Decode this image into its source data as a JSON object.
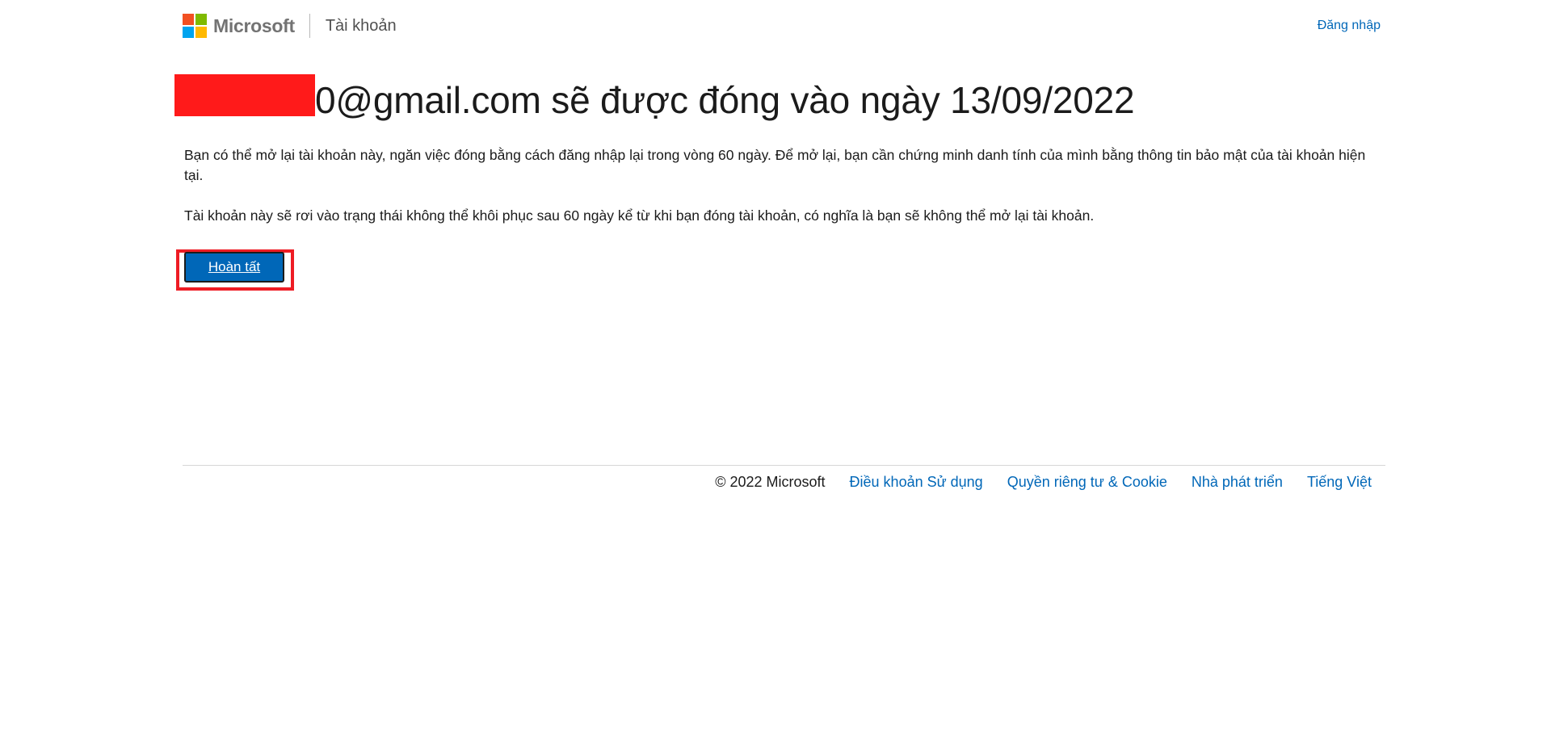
{
  "header": {
    "brand": "Microsoft",
    "section": "Tài khoản",
    "signin": "Đăng nhập",
    "logo_colors": [
      "#f25022",
      "#7fba00",
      "#00a4ef",
      "#ffb900"
    ]
  },
  "main": {
    "title": "0@gmail.com sẽ được đóng vào ngày 13/09/2022",
    "paragraph1": "Bạn có thể mở lại tài khoản này, ngăn việc đóng bằng cách đăng nhập lại trong vòng 60 ngày. Để mở lại, bạn cần chứng minh danh tính của mình bằng thông tin bảo mật của tài khoản hiện tại.",
    "paragraph2": "Tài khoản này sẽ rơi vào trạng thái không thể khôi phục sau 60 ngày kể từ khi bạn đóng tài khoản, có nghĩa là bạn sẽ không thể mở lại tài khoản.",
    "done_button": "Hoàn tất"
  },
  "footer": {
    "copyright": "© 2022 Microsoft",
    "links": [
      "Điều khoản Sử dụng",
      "Quyền riêng tư & Cookie",
      "Nhà phát triển",
      "Tiếng Việt"
    ]
  },
  "colors": {
    "accent": "#0067b8",
    "redaction": "#ff1a1a",
    "highlight": "#ee1c24"
  }
}
